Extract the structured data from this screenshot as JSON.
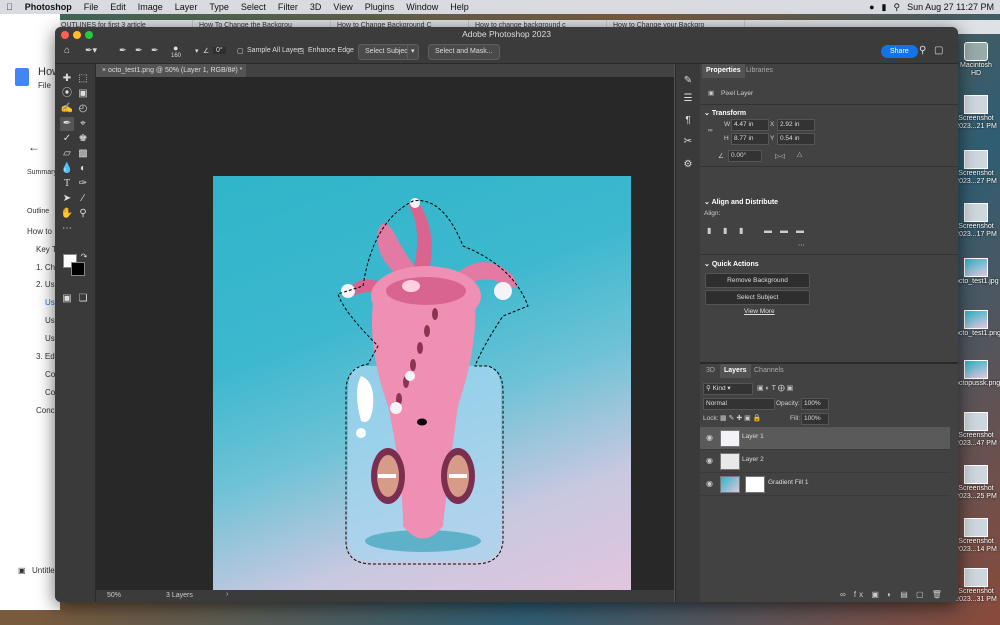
{
  "menubar": {
    "apple": "",
    "items": [
      "Photoshop",
      "File",
      "Edit",
      "Image",
      "Layer",
      "Type",
      "Select",
      "Filter",
      "3D",
      "View",
      "Plugins",
      "Window",
      "Help"
    ],
    "clock": "Sun Aug 27  11:27 PM"
  },
  "browser": {
    "tabs": [
      "OUTLINES for first 3 article",
      "How To Change the Backgrou",
      "How to Change Background C",
      "How to change background c",
      "How to Change your Backgro"
    ],
    "doc_title": "How",
    "doc_menu": "File",
    "outline_items": [
      "Summary",
      "Outline",
      "How to",
      "Key T",
      "1. Ch",
      "2. Us",
      "Us",
      "Us",
      "Us",
      "3. Ed",
      "Co",
      "Co",
      "Conc"
    ],
    "bottom_doc": "Untitle"
  },
  "desktop": {
    "items": [
      "Macintosh HD",
      "Screenshot 2023...21 PM",
      "Screenshot 2023...27 PM",
      "Screenshot 2023...17 PM",
      "octo_test1.jpg",
      "octo_test1.png",
      "octopussk.png",
      "Screenshot 2023...47 PM",
      "Screenshot 2023...25 PM",
      "Screenshot 2023...14 PM",
      "Screenshot 2023...31 PM"
    ]
  },
  "photoshop": {
    "window_title": "Adobe Photoshop 2023",
    "options": {
      "brush_size": "160",
      "angle": "0°",
      "sample_all_layers": "Sample All Layers",
      "enhance_edge": "Enhance Edge",
      "select_subject": "Select Subject",
      "select_and_mask": "Select and Mask...",
      "share": "Share"
    },
    "doc_tab": "octo_test1.png @ 50% (Layer 1, RGB/8#) *",
    "status": {
      "zoom": "50%",
      "info": "3 Layers"
    },
    "properties": {
      "tabs": [
        "Properties",
        "Libraries"
      ],
      "kind": "Pixel Layer",
      "transform_title": "Transform",
      "w_label": "W",
      "w": "4.47 in",
      "h_label": "H",
      "h": "8.77 in",
      "x_label": "X",
      "x": "2.92 in",
      "y_label": "Y",
      "y": "0.54 in",
      "angle": "0.00°",
      "align_title": "Align and Distribute",
      "align_label": "Align:",
      "quick_title": "Quick Actions",
      "remove_bg": "Remove Background",
      "select_subject": "Select Subject",
      "view_more": "View More"
    },
    "layers_panel": {
      "tabs": [
        "3D",
        "Layers",
        "Channels"
      ],
      "kind": "Kind",
      "blend": "Normal",
      "opacity_label": "Opacity:",
      "opacity": "100%",
      "lock_label": "Lock:",
      "fill_label": "Fill:",
      "fill": "100%",
      "layers": [
        "Layer 1",
        "Layer 2",
        "Gradient Fill 1"
      ]
    }
  },
  "colors": {
    "accent": "#1473e6",
    "canvas_teal": "#2fb5c9",
    "canvas_pink": "#e2c5de",
    "octopus": "#ef8fb3"
  }
}
